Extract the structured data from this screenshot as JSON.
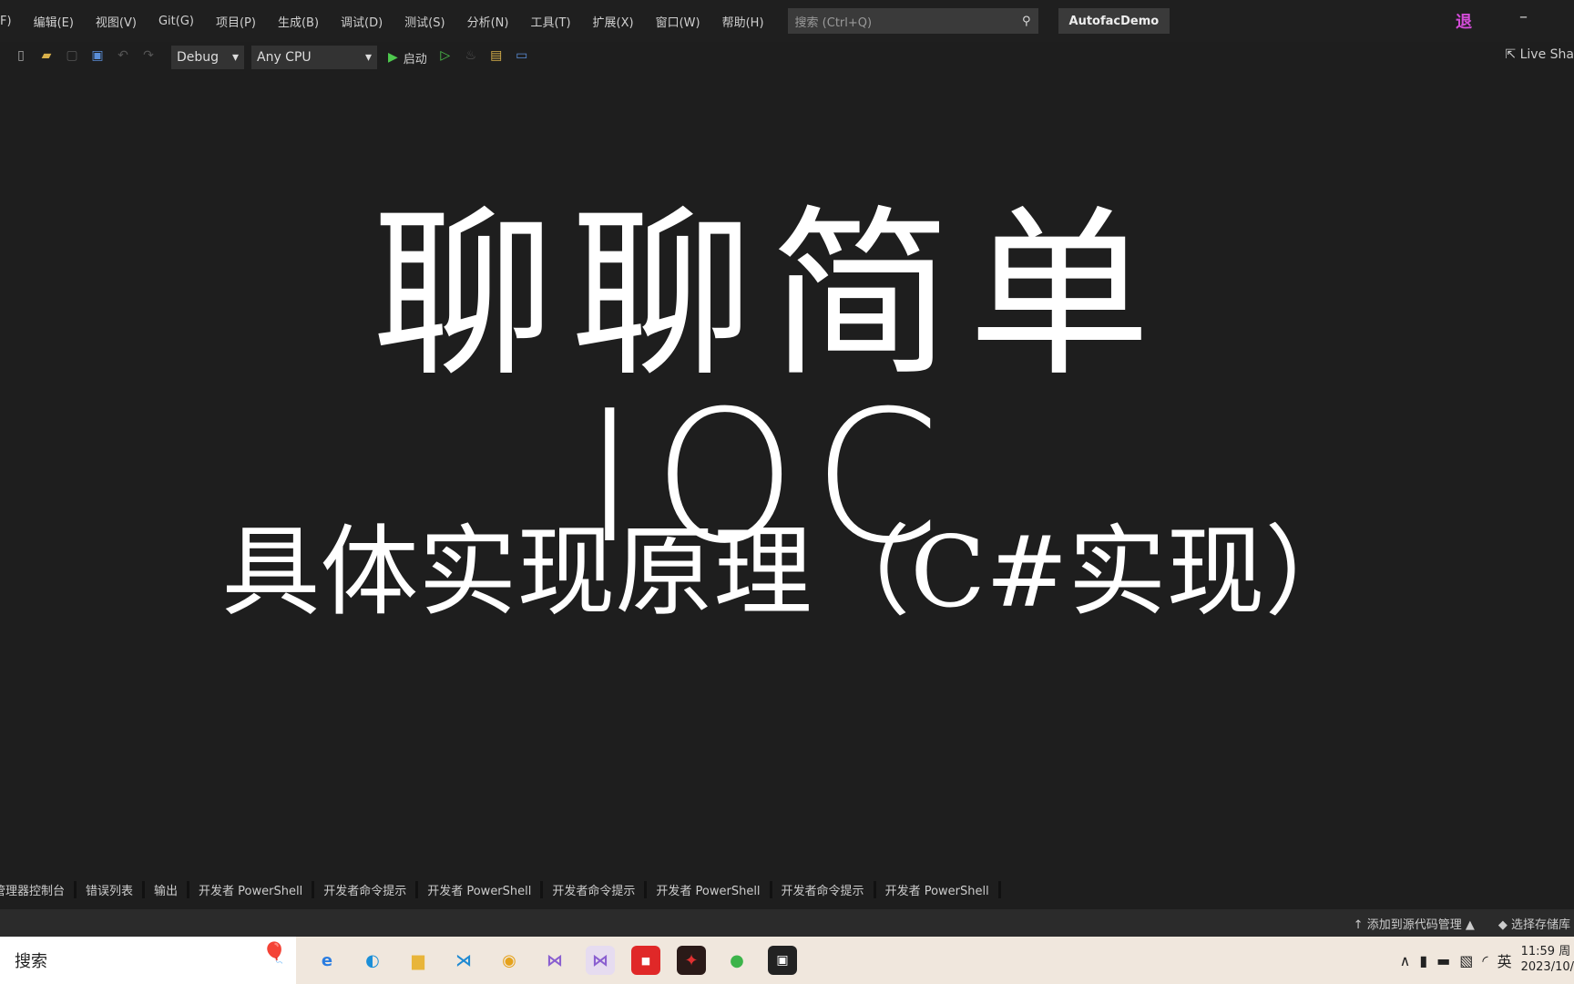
{
  "menubar": {
    "items": [
      "F)",
      "编辑(E)",
      "视图(V)",
      "Git(G)",
      "项目(P)",
      "生成(B)",
      "调试(D)",
      "测试(S)",
      "分析(N)",
      "工具(T)",
      "扩展(X)",
      "窗口(W)",
      "帮助(H)"
    ],
    "search_placeholder": "搜索 (Ctrl+Q)",
    "project": "AutofacDemo",
    "badge": "退",
    "minimize": "–"
  },
  "toolbar": {
    "config": "Debug",
    "platform": "Any CPU",
    "start": "启动",
    "live_share": "Live Sha"
  },
  "content": {
    "title": "聊聊简单IOC",
    "subtitle": "具体实现原理（C#实现）"
  },
  "bottom_tabs": [
    "程序包管理器控制台",
    "错误列表",
    "输出",
    "开发者 PowerShell",
    "开发者命令提示",
    "开发者 PowerShell",
    "开发者命令提示",
    "开发者 PowerShell",
    "开发者命令提示",
    "开发者 PowerShell"
  ],
  "status": {
    "source_control": "添加到源代码管理 ▲",
    "repo": "选择存储库"
  },
  "taskbar": {
    "search": "搜索",
    "ime": "英",
    "time": "11:59 周",
    "date": "2023/10/"
  }
}
